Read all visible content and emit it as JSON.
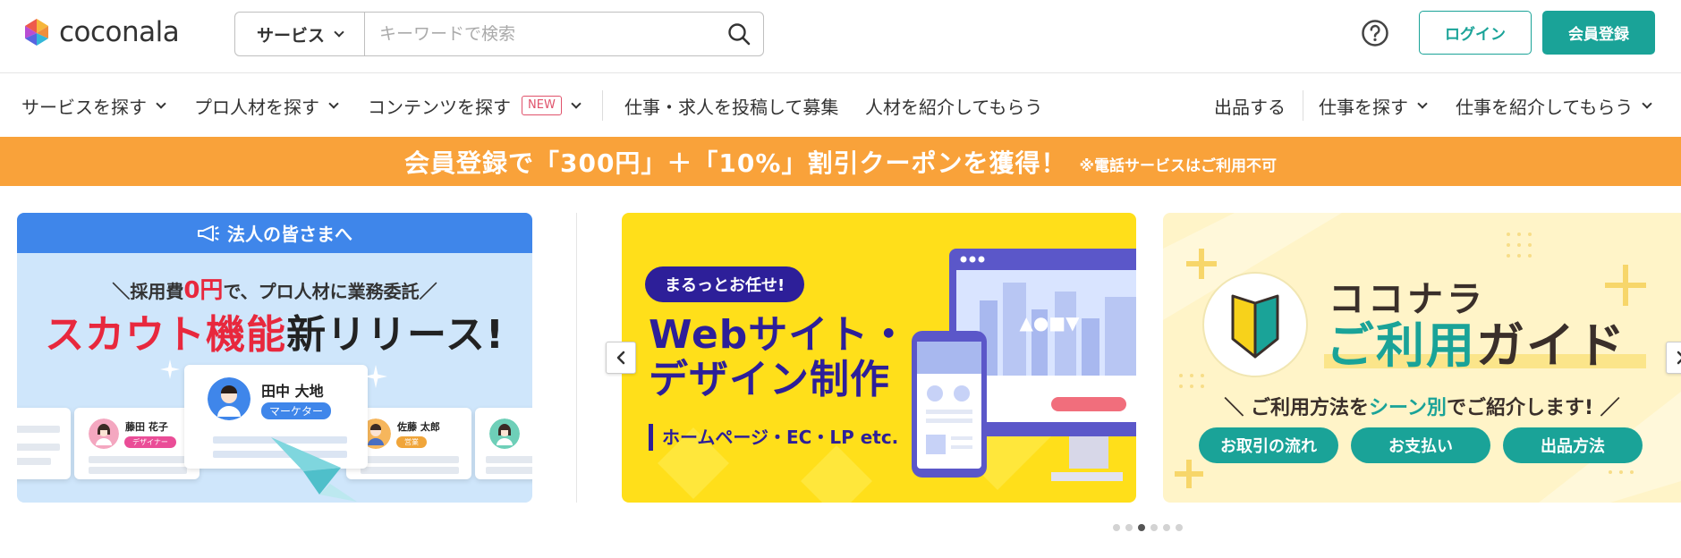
{
  "header": {
    "logo_text": "coconala",
    "search_category": "サービス",
    "search_placeholder": "キーワードで検索",
    "login_label": "ログイン",
    "signup_label": "会員登録"
  },
  "nav": {
    "left": [
      {
        "label": "サービスを探す"
      },
      {
        "label": "プロ人材を探す"
      },
      {
        "label": "コンテンツを探す",
        "badge": "NEW"
      },
      {
        "label": "仕事・求人を投稿して募集"
      },
      {
        "label": "人材を紹介してもらう"
      }
    ],
    "right": [
      {
        "label": "出品する"
      },
      {
        "label": "仕事を探す"
      },
      {
        "label": "仕事を紹介してもらう"
      }
    ]
  },
  "promo": {
    "main": "会員登録で「300円」＋「10%」割引クーポンを獲得！",
    "note": "※電話サービスはご利用不可"
  },
  "banners": {
    "corporate": {
      "header": "法人の皆さまへ",
      "sub_pre": "採用費",
      "sub_zero": "0円",
      "sub_post": "で、プロ人材に業務委託",
      "main_red": "スカウト機能",
      "main_dark": "新リリース!",
      "card_main_name": "田中 大地",
      "card_main_tag": "マーケター",
      "card_left_name": "藤田 花子",
      "card_left_tag": "デザイナー",
      "card_right_name": "佐藤 太郎",
      "card_right_tag": "営業"
    },
    "web": {
      "pill": "まるっとお任せ!",
      "title_line1": "Webサイト・",
      "title_line2": "デザイン制作",
      "sub": "ホームページ・EC・LP etc."
    },
    "guide": {
      "title1": "ココナラ",
      "title2_teal": "ご利用",
      "title2_brown": "ガイド",
      "desc_pre": "ご利用方法を",
      "desc_teal": "シーン別",
      "desc_post": "でご紹介します!",
      "buttons": [
        "お取引の流れ",
        "お支払い",
        "出品方法"
      ]
    }
  },
  "carousel": {
    "dots": 6,
    "active_dot": 3
  },
  "colors": {
    "brand_teal": "#1aa398",
    "promo_orange": "#f9a23a",
    "web_navy": "#2d1f99",
    "corporate_blue": "#3f86ea",
    "accent_red": "#e8283d"
  }
}
